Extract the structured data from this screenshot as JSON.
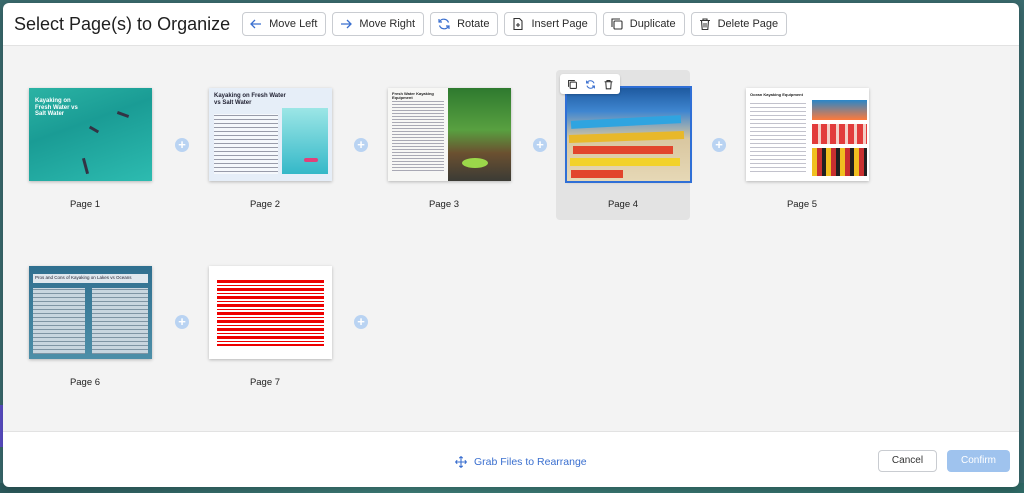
{
  "header": {
    "title": "Select Page(s) to Organize",
    "toolbar": [
      {
        "label": "Move Left",
        "icon": "arrow-left-icon"
      },
      {
        "label": "Move Right",
        "icon": "arrow-right-icon"
      },
      {
        "label": "Rotate",
        "icon": "rotate-icon"
      },
      {
        "label": "Insert Page",
        "icon": "insert-page-icon"
      },
      {
        "label": "Duplicate",
        "icon": "duplicate-icon"
      },
      {
        "label": "Delete Page",
        "icon": "trash-icon"
      }
    ]
  },
  "pages": [
    {
      "label": "Page 1",
      "thumb_title": "Kayaking on Fresh Water vs Salt Water"
    },
    {
      "label": "Page 2",
      "thumb_title": "Kayaking on Fresh Water vs Salt Water"
    },
    {
      "label": "Page 3",
      "thumb_title": "Fresh Water Kayaking Equipment"
    },
    {
      "label": "Page 4",
      "selected": true
    },
    {
      "label": "Page 5",
      "thumb_title": "Ocean Kayaking Equipment"
    },
    {
      "label": "Page 6",
      "thumb_title": "Pros and Cons of Kayaking on Lakes vs Oceans"
    },
    {
      "label": "Page 7"
    }
  ],
  "footer": {
    "grab_label": "Grab Files to Rearrange",
    "cancel_label": "Cancel",
    "confirm_label": "Confirm"
  },
  "colors": {
    "accent": "#2f6fd6",
    "confirm_bg": "#9fc3ee",
    "plus_bg": "#b9d3f2"
  }
}
